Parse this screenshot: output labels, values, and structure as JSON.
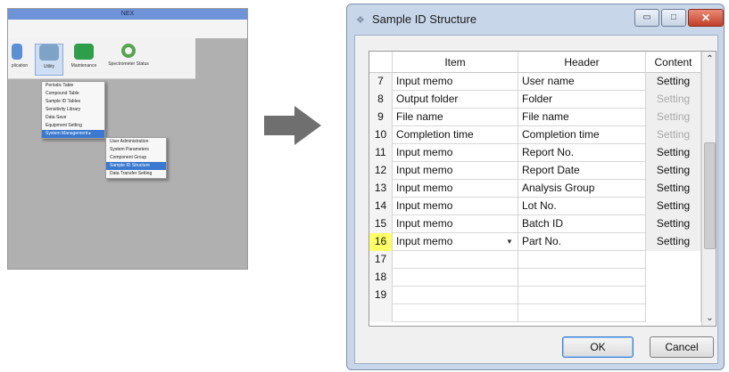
{
  "left_app": {
    "title": "NEX",
    "toolbar": [
      {
        "label": "plication",
        "key": "app"
      },
      {
        "label": "Utility",
        "key": "util"
      },
      {
        "label": "Maintenance",
        "key": "maint"
      },
      {
        "label": "Spectrometer Status",
        "key": "spec"
      }
    ],
    "utility_menu": [
      "Periodic Table",
      "Compound Table",
      "Sample ID Tables",
      "Sensitivity Library",
      "Data Save",
      "Equipment Setting",
      "System Management ▸"
    ],
    "system_management_menu": [
      "User Administration",
      "System Parameters",
      "Component Group",
      "Sample ID Structure",
      "Data Transfer Setting"
    ]
  },
  "colors": {
    "accent": "#3a79cf",
    "selected_row": "#ffff66",
    "arrow": "#6f6f6f"
  },
  "dialog": {
    "title": "Sample ID Structure",
    "title_icon": "window-icon",
    "caption": {
      "minimize": "▭",
      "maximize": "□",
      "close": "✕"
    },
    "grid": {
      "columns": [
        "",
        "Item",
        "Header",
        "Content"
      ],
      "rows": [
        {
          "no": "7",
          "item": "Input memo",
          "header": "User name",
          "content": "Setting",
          "enabled": true
        },
        {
          "no": "8",
          "item": "Output folder",
          "header": "Folder",
          "content": "Setting",
          "enabled": false
        },
        {
          "no": "9",
          "item": "File name",
          "header": "File name",
          "content": "Setting",
          "enabled": false
        },
        {
          "no": "10",
          "item": "Completion time",
          "header": "Completion time",
          "content": "Setting",
          "enabled": false
        },
        {
          "no": "11",
          "item": "Input memo",
          "header": "Report No.",
          "content": "Setting",
          "enabled": true
        },
        {
          "no": "12",
          "item": "Input memo",
          "header": "Report Date",
          "content": "Setting",
          "enabled": true
        },
        {
          "no": "13",
          "item": "Input memo",
          "header": "Analysis Group",
          "content": "Setting",
          "enabled": true
        },
        {
          "no": "14",
          "item": "Input memo",
          "header": "Lot No.",
          "content": "Setting",
          "enabled": true
        },
        {
          "no": "15",
          "item": "Input memo",
          "header": "Batch ID",
          "content": "Setting",
          "enabled": true
        },
        {
          "no": "16",
          "item": "Input memo",
          "header": "Part No.",
          "content": "Setting",
          "enabled": true,
          "selected": true
        },
        {
          "no": "17",
          "item": "",
          "header": "",
          "content": ""
        },
        {
          "no": "18",
          "item": "",
          "header": "",
          "content": ""
        },
        {
          "no": "19",
          "item": "",
          "header": "",
          "content": ""
        },
        {
          "no": "",
          "item": "",
          "header": "",
          "content": ""
        }
      ]
    },
    "ok_label": "OK",
    "cancel_label": "Cancel"
  }
}
